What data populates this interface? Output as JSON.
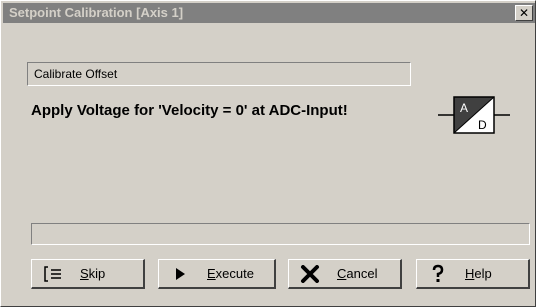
{
  "window": {
    "title": "Setpoint Calibration [Axis 1]",
    "close_glyph": "✕"
  },
  "mode": {
    "label": "Calibrate Offset"
  },
  "instruction": {
    "text": "Apply Voltage for 'Velocity = 0' at ADC-Input!"
  },
  "adc_icon": {
    "top_label": "A",
    "bottom_label": "D",
    "icon": "adc-converter-icon"
  },
  "progress": {
    "value": 0
  },
  "buttons": {
    "skip": {
      "mnemonic": "S",
      "rest": "kip",
      "icon": "skip-icon"
    },
    "execute": {
      "mnemonic": "E",
      "rest": "xecute",
      "icon": "play-icon"
    },
    "cancel": {
      "mnemonic": "C",
      "rest": "ancel",
      "icon": "cancel-x-icon"
    },
    "help": {
      "mnemonic": "H",
      "rest": "elp",
      "icon": "question-icon"
    }
  },
  "colors": {
    "titlebar_inactive": "#808080",
    "face": "#d4d0c8"
  }
}
